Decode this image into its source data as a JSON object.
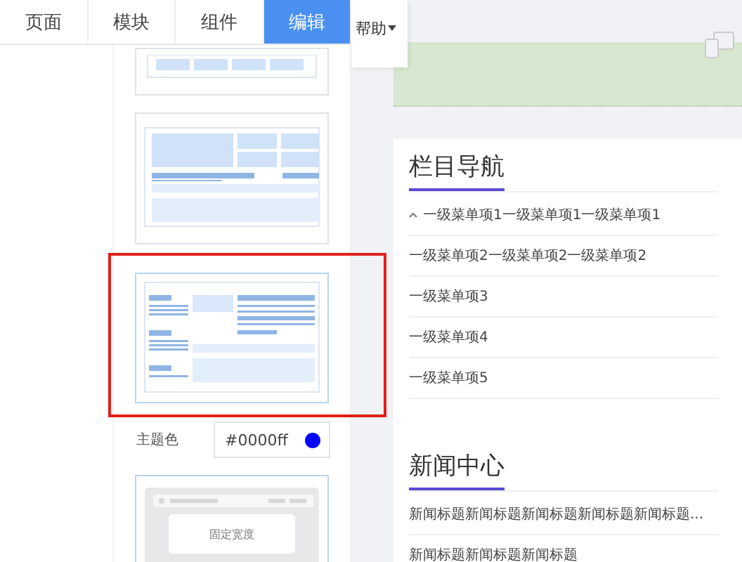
{
  "tabs": [
    {
      "label": "页面",
      "selected": false
    },
    {
      "label": "模块",
      "selected": false
    },
    {
      "label": "组件",
      "selected": false
    },
    {
      "label": "编辑",
      "selected": true
    }
  ],
  "help_menu": {
    "label": "帮助"
  },
  "templates": [
    {
      "kind": "strip",
      "selected": false
    },
    {
      "kind": "grid",
      "selected": false
    },
    {
      "kind": "columns",
      "selected": true
    },
    {
      "kind": "fixed",
      "label": "固定宽度",
      "selected": false
    }
  ],
  "theme_color": {
    "label": "主题色",
    "value": "#0000ff",
    "color": "#0000ff"
  },
  "preview": {
    "nav_title": "栏目导航",
    "nav_items": [
      {
        "label": "一级菜单项1一级菜单项1一级菜单项1",
        "expanded": true
      },
      {
        "label": "一级菜单项2一级菜单项2一级菜单项2",
        "expanded": false
      },
      {
        "label": "一级菜单项3",
        "expanded": false
      },
      {
        "label": "一级菜单项4",
        "expanded": false
      },
      {
        "label": "一级菜单项5",
        "expanded": false
      }
    ],
    "news_title": "新闻中心",
    "news_items": [
      "新闻标题新闻标题新闻标题新闻标题新闻标题...",
      "新闻标题新闻标题新闻标题"
    ]
  }
}
